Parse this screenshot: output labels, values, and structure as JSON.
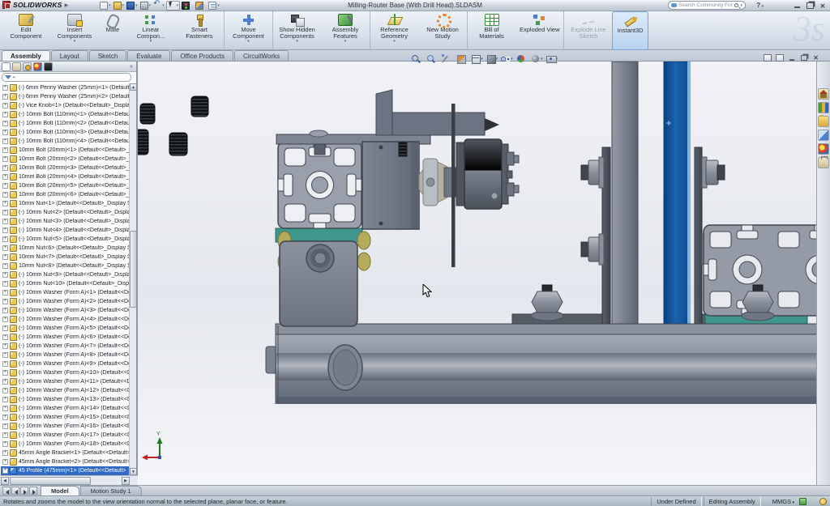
{
  "window": {
    "brand": "SOLIDWORKS",
    "title": "Milling-Router Base (With Drill Head).SLDASM"
  },
  "titlebar": {
    "search_placeholder": "Search Community Forum",
    "help_label": "?",
    "std_tools": [
      {
        "icon": "ic-new",
        "caret": true
      },
      {
        "icon": "ic-open",
        "caret": true
      },
      {
        "icon": "ic-save",
        "caret": true
      },
      {
        "icon": "ic-print",
        "caret": true
      },
      {
        "icon": "ic-undo",
        "caret": true
      },
      {
        "icon": "ic-select",
        "caret": true,
        "boxed": true
      },
      {
        "icon": "ic-rebuild"
      },
      {
        "icon": "ic-appearance"
      },
      {
        "icon": "ic-options",
        "caret": true
      }
    ]
  },
  "command_manager": {
    "buttons": [
      {
        "label": "Edit Component",
        "icon": "cm-edit"
      },
      {
        "label": "Insert Components",
        "icon": "cm-insert",
        "caret": true
      },
      {
        "label": "Mate",
        "icon": "cm-mate"
      },
      {
        "label": "Linear Compon...",
        "icon": "cm-linear",
        "caret": true
      },
      {
        "label": "Smart Fasteners",
        "icon": "cm-smart"
      },
      {
        "label": "Move Component",
        "icon": "cm-move",
        "caret": true
      },
      {
        "label": "Show Hidden Components",
        "icon": "cm-hidden",
        "caret": true
      },
      {
        "label": "Assembly Features",
        "icon": "cm-feat",
        "caret": true
      },
      {
        "label": "Reference Geometry",
        "icon": "cm-ref",
        "caret": true
      },
      {
        "label": "New Motion Study",
        "icon": "cm-motion"
      },
      {
        "label": "Bill of Materials",
        "icon": "cm-bom"
      },
      {
        "label": "Exploded View",
        "icon": "cm-explview"
      },
      {
        "label": "Explode Line Sketch",
        "icon": "cm-explline",
        "disabled": true
      },
      {
        "label": "Instant3D",
        "icon": "cm-i3d",
        "active": true
      }
    ]
  },
  "ribbon_tabs": [
    {
      "label": "Assembly",
      "active": true
    },
    {
      "label": "Layout"
    },
    {
      "label": "Sketch"
    },
    {
      "label": "Evaluate"
    },
    {
      "label": "Office Products"
    },
    {
      "label": "CircuitWorks"
    }
  ],
  "feature_panel": {
    "header_icons": [
      {
        "icon": "fm-tree",
        "active": true
      },
      {
        "icon": "fm-prop"
      },
      {
        "icon": "fm-cfg"
      },
      {
        "icon": "fm-disp"
      },
      {
        "icon": "fm-dim"
      }
    ],
    "overflow_label": "»",
    "items": [
      {
        "label": "(-) 6mm Penny Washer (25mm)<1> (Default<"
      },
      {
        "label": "(-) 6mm Penny Washer (25mm)<2> (Default<"
      },
      {
        "label": "(-) Vice Knob<1> (Default<<Default>_Display"
      },
      {
        "label": "(-) 10mm Bolt (110mm)<1> (Default<<Defaul"
      },
      {
        "label": "(-) 10mm Bolt (110mm)<2> (Default<<Defaul"
      },
      {
        "label": "(-) 10mm Bolt (110mm)<3> (Default<<Defaul"
      },
      {
        "label": "(-) 10mm Bolt (110mm)<4> (Default<<Defaul"
      },
      {
        "label": "10mm Bolt (20mm)<1> (Default<<Default>_D"
      },
      {
        "label": "10mm Bolt (20mm)<2> (Default<<Default>_D"
      },
      {
        "label": "10mm Bolt (20mm)<3> (Default<<Default>_D"
      },
      {
        "label": "10mm Bolt (20mm)<4> (Default<<Default>_D"
      },
      {
        "label": "10mm Bolt (20mm)<5> (Default<<Default>_D"
      },
      {
        "label": "10mm Bolt (20mm)<6> (Default<<Default>_D"
      },
      {
        "label": "10mm Nut<1> (Default<<Default>_Display S"
      },
      {
        "label": "(-) 10mm Nut<2> (Default<<Default>_Displa"
      },
      {
        "label": "(-) 10mm Nut<3> (Default<<Default>_Displa"
      },
      {
        "label": "(-) 10mm Nut<4> (Default<<Default>_Displa"
      },
      {
        "label": "(-) 10mm Nut<5> (Default<<Default>_Displa"
      },
      {
        "label": "10mm Nut<6> (Default<<Default>_Display S"
      },
      {
        "label": "10mm Nut<7> (Default<<Default>_Display S"
      },
      {
        "label": "10mm Nut<8> (Default<<Default>_Display S"
      },
      {
        "label": "(-) 10mm Nut<9> (Default<<Default>_Displa"
      },
      {
        "label": "(-) 10mm Nut<10> (Default<<Default>_Displ"
      },
      {
        "label": "(-) 10mm Washer (Form A)<1> (Default<<De"
      },
      {
        "label": "(-) 10mm Washer (Form A)<2> (Default<<De"
      },
      {
        "label": "(-) 10mm Washer (Form A)<3> (Default<<De"
      },
      {
        "label": "(-) 10mm Washer (Form A)<4> (Default<<De"
      },
      {
        "label": "(-) 10mm Washer (Form A)<5> (Default<<De"
      },
      {
        "label": "(-) 10mm Washer (Form A)<6> (Default<<De"
      },
      {
        "label": "(-) 10mm Washer (Form A)<7> (Default<<De"
      },
      {
        "label": "(-) 10mm Washer (Form A)<8> (Default<<De"
      },
      {
        "label": "(-) 10mm Washer (Form A)<9> (Default<<De"
      },
      {
        "label": "(-) 10mm Washer (Form A)<10> (Default<<D"
      },
      {
        "label": "(-) 10mm Washer (Form A)<11> (Default<<D"
      },
      {
        "label": "(-) 10mm Washer (Form A)<12> (Default<<D"
      },
      {
        "label": "(-) 10mm Washer (Form A)<13> (Default<<D"
      },
      {
        "label": "(-) 10mm Washer (Form A)<14> (Default<<D"
      },
      {
        "label": "(-) 10mm Washer (Form A)<15> (Default<<D"
      },
      {
        "label": "(-) 10mm Washer (Form A)<16> (Default<<D"
      },
      {
        "label": "(-) 10mm Washer (Form A)<17> (Default<<D"
      },
      {
        "label": "(-) 10mm Washer (Form A)<18> (Default<<D"
      },
      {
        "label": "45mm Angle Bracket<1> (Default<<Default>"
      },
      {
        "label": "45mm Angle Bracket<2> (Default<<Default>"
      },
      {
        "label": "45 Profile (475mm)<1> (Default<<Default>",
        "selected": true
      }
    ]
  },
  "viewport": {
    "headsup": [
      {
        "icon": "hu-magfit"
      },
      {
        "icon": "hu-magarea"
      },
      {
        "icon": "hu-wand"
      },
      {
        "icon": "hu-sect"
      },
      {
        "icon": "hu-view",
        "caret": true
      },
      {
        "icon": "hu-style",
        "caret": true
      },
      {
        "icon": "hu-vis",
        "caret": true
      },
      {
        "icon": "hu-appr"
      },
      {
        "icon": "hu-scene",
        "caret": true
      },
      {
        "icon": "hu-cam",
        "caret": true
      }
    ],
    "doc_controls": [
      {
        "icon": "dc-win"
      },
      {
        "icon": "dc-win"
      },
      {
        "icon": "dc-min"
      },
      {
        "icon": "dc-restore"
      },
      {
        "icon": "dc-close"
      }
    ],
    "taskpane_icons": [
      {
        "icon": "tp-home"
      },
      {
        "icon": "tp-lib"
      },
      {
        "icon": "tp-folder"
      },
      {
        "icon": "tp-expl"
      },
      {
        "icon": "tp-appr"
      },
      {
        "icon": "tp-props"
      }
    ],
    "triad": {
      "y_label": "Y"
    }
  },
  "bottom_tabs": {
    "nav": [
      {
        "icon": "nav-first"
      },
      {
        "icon": "nav-prev"
      },
      {
        "icon": "nav-next"
      },
      {
        "icon": "nav-last"
      }
    ],
    "tabs": [
      {
        "label": "Model",
        "active": true
      },
      {
        "label": "Motion Study 1"
      }
    ]
  },
  "status_bar": {
    "message": "Rotates and zooms the model to the view orientation normal to the selected plane, planar face, or feature.",
    "cells": [
      "Under Defined",
      "Editing Assembly"
    ],
    "units": "MMGS"
  },
  "colors": {
    "selection": "#316ac5",
    "blue_panel": "#0f4f93",
    "teal_bracket": "#3f968c"
  }
}
